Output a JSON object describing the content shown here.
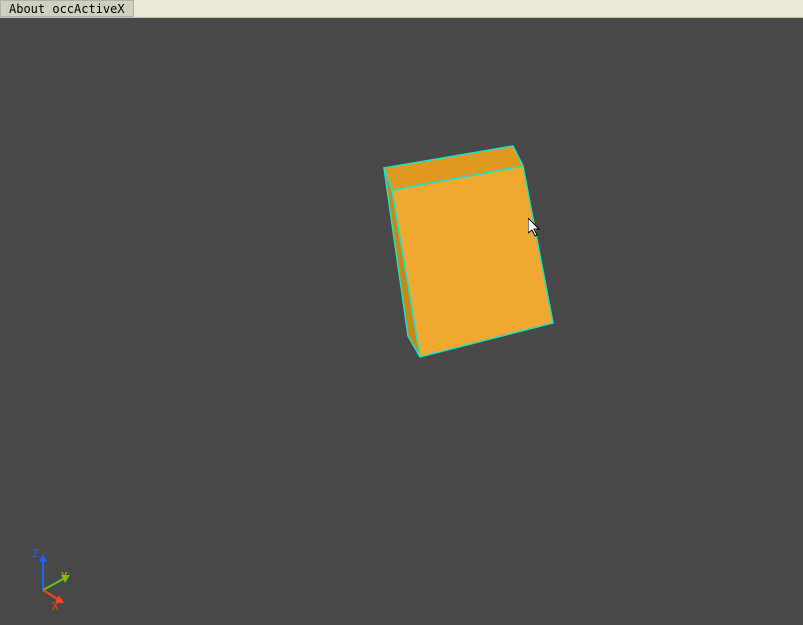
{
  "menu": {
    "about_label": "About occActiveX"
  },
  "viewport": {
    "background_color": "#484848",
    "shape": {
      "type": "box",
      "face_color": "#f0a830",
      "edge_color": "#20e0c0",
      "shadow_color": "#d08820"
    },
    "axis": {
      "z": {
        "label": "Z",
        "color": "#2060ff"
      },
      "y": {
        "label": "Y",
        "color": "#e0a000"
      },
      "x": {
        "label": "X",
        "color": "#ff4020"
      }
    }
  }
}
